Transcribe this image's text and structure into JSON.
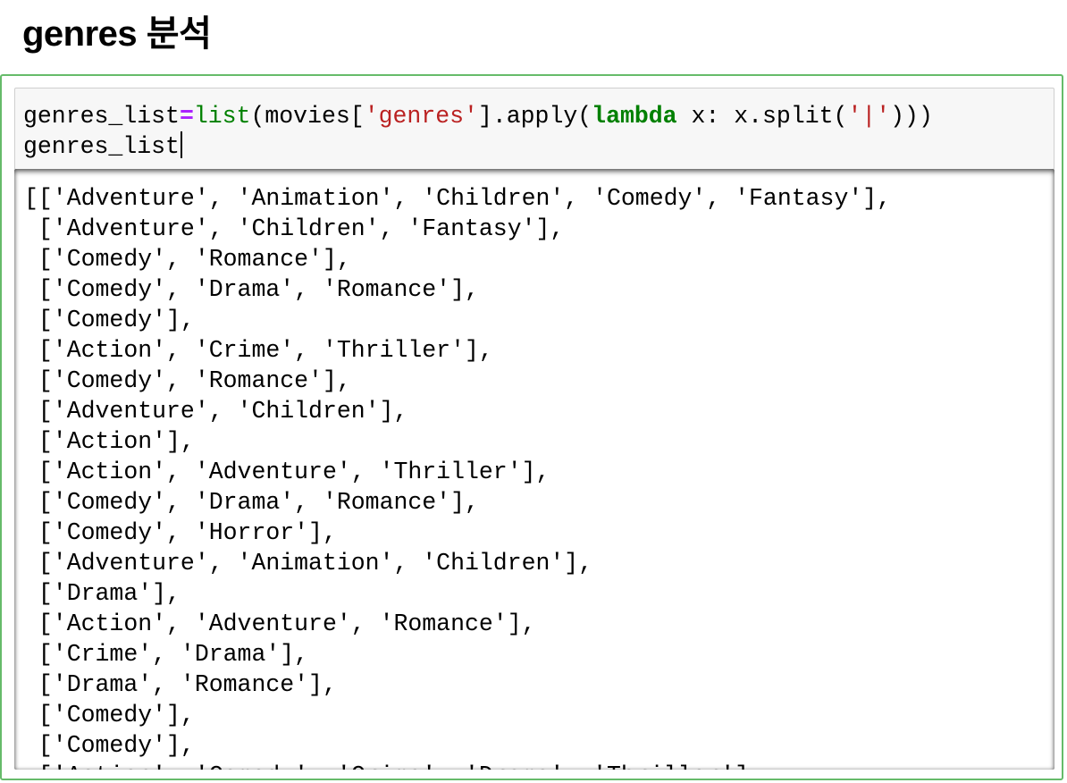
{
  "heading": "genres 분석",
  "code": {
    "line1": {
      "var": "genres_list",
      "op": "=",
      "builtin": "list",
      "part1": "(movies[",
      "str1": "'genres'",
      "part2": "].apply(",
      "kw": "lambda",
      "part3": " x: x.split(",
      "str2": "'|'",
      "part4": ")))"
    },
    "line2": "genres_list"
  },
  "output": {
    "lines": [
      "[['Adventure', 'Animation', 'Children', 'Comedy', 'Fantasy'],",
      " ['Adventure', 'Children', 'Fantasy'],",
      " ['Comedy', 'Romance'],",
      " ['Comedy', 'Drama', 'Romance'],",
      " ['Comedy'],",
      " ['Action', 'Crime', 'Thriller'],",
      " ['Comedy', 'Romance'],",
      " ['Adventure', 'Children'],",
      " ['Action'],",
      " ['Action', 'Adventure', 'Thriller'],",
      " ['Comedy', 'Drama', 'Romance'],",
      " ['Comedy', 'Horror'],",
      " ['Adventure', 'Animation', 'Children'],",
      " ['Drama'],",
      " ['Action', 'Adventure', 'Romance'],",
      " ['Crime', 'Drama'],",
      " ['Drama', 'Romance'],",
      " ['Comedy'],",
      " ['Comedy'],",
      " ['Action', 'Comedy', 'Crime', 'Drama', 'Thriller'],"
    ]
  },
  "colors": {
    "cell_border": "#66bb6a",
    "input_bg": "#f7f7f7",
    "string": "#ba2121",
    "keyword": "#008000",
    "operator": "#aa22ff"
  }
}
